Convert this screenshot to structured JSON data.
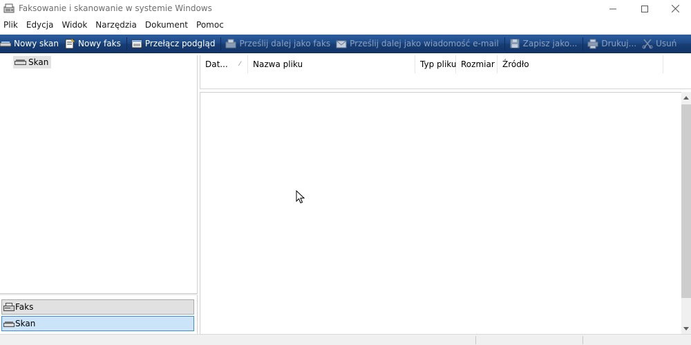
{
  "window": {
    "title": "Faksowanie i skanowanie w systemie Windows",
    "minimize_icon": "minimize-icon",
    "maximize_icon": "maximize-icon",
    "close_icon": "close-icon"
  },
  "menu": {
    "items": [
      "Plik",
      "Edycja",
      "Widok",
      "Narzędzia",
      "Dokument",
      "Pomoc"
    ]
  },
  "toolbar": {
    "new_scan": "Nowy skan",
    "new_fax": "Nowy faks",
    "toggle_preview": "Przełącz podgląd",
    "forward_fax": "Prześlij dalej jako faks",
    "forward_email": "Prześlij dalej jako wiadomość e-mail",
    "save_as": "Zapisz jako...",
    "print": "Drukuj...",
    "delete": "Usuń"
  },
  "tree": {
    "selected_folder": "Skan"
  },
  "list": {
    "columns": [
      "Dat...",
      "Nazwa pliku",
      "Typ pliku",
      "Rozmiar",
      "Źródło"
    ],
    "sort_indicator": "⁄",
    "rows": []
  },
  "nav": {
    "fax": "Faks",
    "scan": "Skan",
    "active": "Skan"
  },
  "colors": {
    "toolbar": "#1e4a88",
    "nav_selected": "#cce4f7",
    "nav_selected_border": "#3b8ede"
  }
}
